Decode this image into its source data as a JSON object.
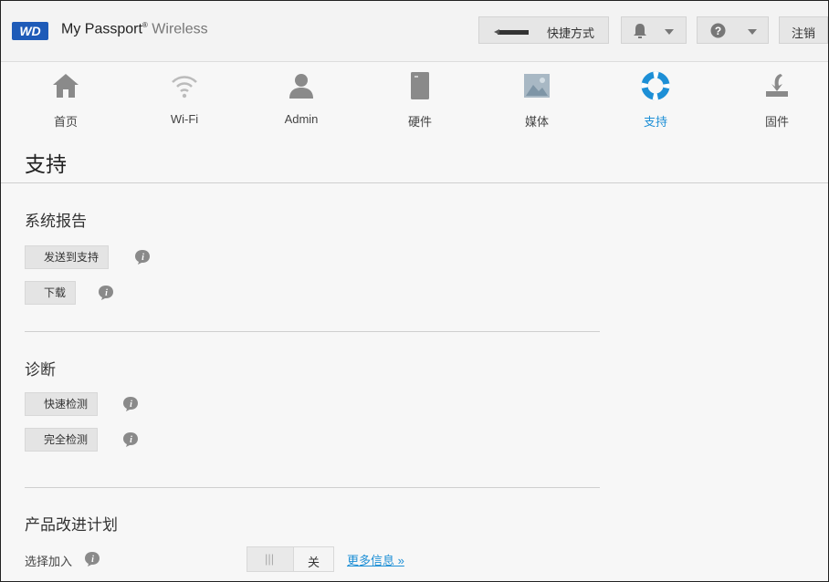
{
  "header": {
    "logo": "WD",
    "product_name": "My Passport",
    "product_suffix": "Wireless",
    "shortcut_label": "快捷方式",
    "logout_label": "注销"
  },
  "nav": {
    "items": [
      {
        "label": "首页",
        "icon": "home-icon"
      },
      {
        "label": "Wi-Fi",
        "icon": "wifi-icon"
      },
      {
        "label": "Admin",
        "icon": "user-icon"
      },
      {
        "label": "硬件",
        "icon": "hardware-icon"
      },
      {
        "label": "媒体",
        "icon": "media-icon"
      },
      {
        "label": "支持",
        "icon": "support-icon",
        "active": true
      },
      {
        "label": "固件",
        "icon": "firmware-icon"
      }
    ]
  },
  "page": {
    "title": "支持",
    "system_report": {
      "heading": "系统报告",
      "send_button": "发送到支持",
      "download_button": "下载"
    },
    "diagnostics": {
      "heading": "诊断",
      "quick_test_button": "快速检测",
      "full_test_button": "完全检测"
    },
    "improvement": {
      "heading": "产品改进计划",
      "opt_in_label": "选择加入",
      "toggle_grip": "|||",
      "toggle_state": "关",
      "more_info_link": "更多信息 »"
    }
  },
  "colors": {
    "accent": "#1d8fd6",
    "logo_bg": "#1e5bb8"
  }
}
